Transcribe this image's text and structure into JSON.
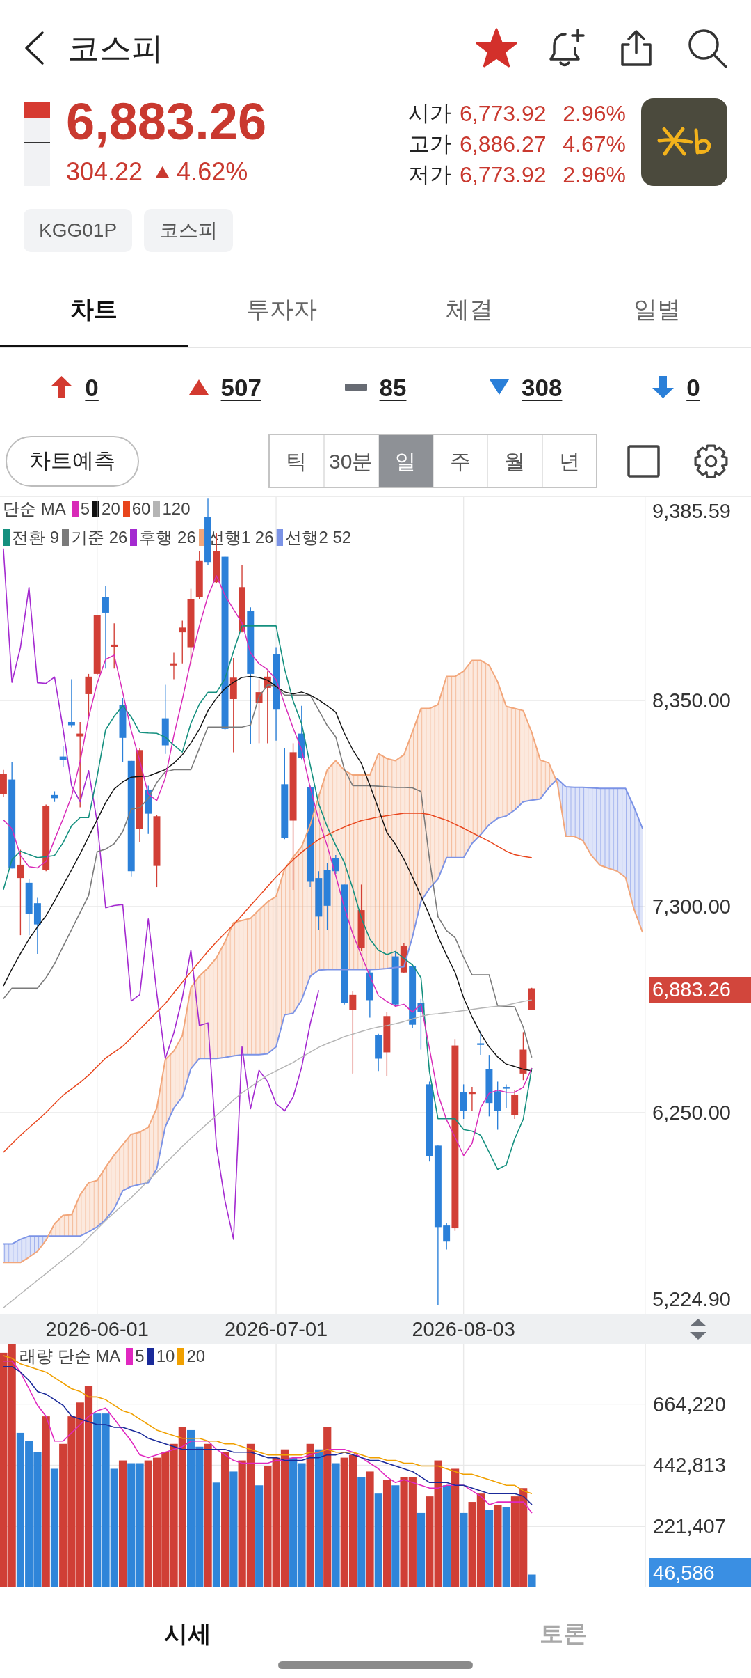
{
  "top_bar": {
    "title": "코스피",
    "favorite": true
  },
  "quote": {
    "gauge": {
      "level": 0.19
    },
    "price": "6,883.26",
    "change": "304.22",
    "rising": true,
    "change_rate": "4.62%",
    "ohlc": [
      {
        "label": "시가",
        "value": "6,773.92",
        "rate": "2.96%"
      },
      {
        "label": "고가",
        "value": "6,886.27",
        "rate": "4.67%"
      },
      {
        "label": "저가",
        "value": "6,773.92",
        "rate": "2.96%"
      }
    ]
  },
  "tags": [
    "KGG01P",
    "코스피"
  ],
  "tabs": [
    {
      "label": "차트",
      "selected": true
    },
    {
      "label": "투자자",
      "selected": false
    },
    {
      "label": "체결",
      "selected": false
    },
    {
      "label": "일별",
      "selected": false
    }
  ],
  "breadth": [
    {
      "kind": "upper_limit",
      "count": "0"
    },
    {
      "kind": "rise",
      "count": "507"
    },
    {
      "kind": "flat",
      "count": "85"
    },
    {
      "kind": "fall",
      "count": "308"
    },
    {
      "kind": "lower_limit",
      "count": "0"
    }
  ],
  "chart_toolbar": {
    "forecast_button": "차트예측",
    "periods": [
      {
        "label": "틱",
        "selected": false
      },
      {
        "label": "30분",
        "selected": false
      },
      {
        "label": "일",
        "selected": true
      },
      {
        "label": "주",
        "selected": false
      },
      {
        "label": "월",
        "selected": false
      },
      {
        "label": "년",
        "selected": false
      }
    ]
  },
  "price_chart": {
    "ma_legend_label": "단순 MA",
    "current_price": "6,883.26",
    "chart_data": {
      "type": "candlestick",
      "legend": "upper left",
      "grid": true,
      "categories": [
        null,
        null,
        null,
        null,
        null,
        null,
        null,
        null,
        null,
        null,
        null,
        "2026-06-01",
        null,
        null,
        null,
        null,
        null,
        null,
        null,
        null,
        null,
        null,
        null,
        null,
        null,
        null,
        null,
        null,
        null,
        null,
        null,
        null,
        "2026-07-01",
        null,
        null,
        null,
        null,
        null,
        null,
        null,
        null,
        null,
        null,
        null,
        null,
        null,
        null,
        null,
        null,
        null,
        null,
        null,
        null,
        null,
        "2026-08-03",
        null,
        null,
        null,
        null,
        null,
        null,
        null,
        null,
        null,
        null,
        null,
        null,
        null,
        null,
        null,
        null,
        null,
        null,
        null,
        null,
        null
      ],
      "ylim": [
        5224.9,
        9385.59
      ],
      "yticks": [
        {
          "value": 9385.59,
          "label": "9,385.59"
        },
        {
          "value": 8350,
          "label": "8,350.00"
        },
        {
          "value": 7300,
          "label": "7,300.00"
        },
        {
          "value": 6250,
          "label": "6,250.00"
        },
        {
          "value": 5224.9,
          "label": "5,224.90"
        }
      ],
      "ohlc": [
        [
          7874,
          7996,
          7860,
          7977
        ],
        [
          7947,
          8037,
          7494,
          7494
        ],
        [
          7445,
          7589,
          7154,
          7513
        ],
        [
          7421,
          7440,
          7154,
          7263
        ],
        [
          7317,
          7344,
          7059,
          7209
        ],
        [
          7486,
          7820,
          7480,
          7811
        ],
        [
          7868,
          7887,
          7833,
          7852
        ],
        [
          8064,
          8118,
          8010,
          8045
        ],
        [
          8240,
          8458,
          8213,
          8224
        ],
        [
          8167,
          8240,
          7805,
          8181
        ],
        [
          8382,
          8485,
          8268,
          8471
        ],
        [
          8485,
          8783,
          8479,
          8783
        ],
        [
          8878,
          8933,
          8512,
          8797
        ],
        [
          8623,
          8743,
          8512,
          8634
        ],
        [
          8327,
          8363,
          8037,
          8159
        ],
        [
          8042,
          8042,
          7453,
          7480
        ],
        [
          7697,
          8105,
          7630,
          8097
        ],
        [
          7896,
          7915,
          7670,
          7773
        ],
        [
          7507,
          7765,
          7399,
          7760
        ],
        [
          8259,
          8430,
          8078,
          8121
        ],
        [
          8528,
          8593,
          8458,
          8539
        ],
        [
          8697,
          8756,
          8539,
          8721
        ],
        [
          8621,
          8919,
          8539,
          8865
        ],
        [
          8878,
          9109,
          8865,
          9060
        ],
        [
          9286,
          9381,
          9041,
          9055
        ],
        [
          8952,
          9204,
          8946,
          9109
        ],
        [
          9082,
          9082,
          8200,
          8205
        ],
        [
          8357,
          8566,
          8086,
          8466
        ],
        [
          8702,
          9041,
          8697,
          8927
        ],
        [
          8805,
          8824,
          8126,
          8485
        ],
        [
          8338,
          8458,
          8132,
          8392
        ],
        [
          8414,
          8498,
          8132,
          8471
        ],
        [
          8585,
          8621,
          8145,
          8303
        ],
        [
          7923,
          8105,
          7643,
          7649
        ],
        [
          7738,
          8132,
          7385,
          8086
        ],
        [
          8181,
          8322,
          8050,
          8059
        ],
        [
          7909,
          7915,
          7399,
          7426
        ],
        [
          7445,
          7480,
          7182,
          7249
        ],
        [
          7486,
          7521,
          7182,
          7304
        ],
        [
          7548,
          7562,
          7467,
          7480
        ],
        [
          7412,
          7412,
          6801,
          6807
        ],
        [
          6774,
          6869,
          6449,
          6850
        ],
        [
          7087,
          7412,
          7073,
          7282
        ],
        [
          6964,
          6978,
          6734,
          6823
        ],
        [
          6644,
          6652,
          6462,
          6525
        ],
        [
          6557,
          6761,
          6435,
          6742
        ],
        [
          7046,
          7073,
          6788,
          6801
        ],
        [
          6964,
          7114,
          6959,
          7100
        ],
        [
          6997,
          7005,
          6679,
          6698
        ],
        [
          6807,
          6829,
          6571,
          6761
        ],
        [
          6394,
          6408,
          6001,
          6028
        ],
        [
          6082,
          6082,
          5268,
          5667
        ],
        [
          5675,
          5688,
          5553,
          5593
        ],
        [
          5661,
          6625,
          5648,
          6592
        ],
        [
          6354,
          6394,
          6218,
          6258
        ],
        [
          6345,
          6381,
          6258,
          6354
        ],
        [
          6603,
          6666,
          6544,
          6595
        ],
        [
          6470,
          6544,
          6231,
          6299
        ],
        [
          6359,
          6408,
          6163,
          6258
        ],
        [
          6381,
          6394,
          6272,
          6372
        ],
        [
          6237,
          6367,
          6218,
          6340
        ],
        [
          6449,
          6660,
          6416,
          6571
        ],
        [
          6774,
          6886,
          6774,
          6883
        ],
        null,
        null,
        null,
        null,
        null,
        null,
        null,
        null,
        null,
        null,
        null,
        null,
        null
      ],
      "series": [
        {
          "name": "5",
          "type": "line",
          "color": "#d82ab8",
          "values": [
            7742,
            7696,
            7560,
            7503,
            7497,
            7530,
            7641,
            7747,
            7861,
            8038,
            8263,
            8437,
            8559,
            8581,
            8391,
            8195,
            8043,
            7872,
            7840,
            7954,
            8171,
            8355,
            8554,
            8730,
            8882,
            8985,
            8885,
            8814,
            8744,
            8592,
            8537,
            8507,
            8456,
            8331,
            8209,
            8098,
            7907,
            7742,
            7609,
            7457,
            7297,
            7161,
            7052,
            6946,
            6846,
            6816,
            6792,
            6802,
            6762,
            6802,
            6577,
            6344,
            6213,
            6124,
            6031,
            6094,
            6276,
            6349,
            6365,
            6354,
            6354,
            6379,
            6477,
            null,
            null,
            null,
            null,
            null,
            null,
            null,
            null,
            null,
            null,
            null,
            null,
            null
          ]
        },
        {
          "name": "20",
          "type": "line",
          "color": "#111111",
          "values": [
            6895,
            6982,
            7060,
            7134,
            7196,
            7253,
            7329,
            7408,
            7487,
            7568,
            7655,
            7742,
            7829,
            7899,
            7935,
            7959,
            7962,
            7964,
            7981,
            7997,
            8030,
            8073,
            8133,
            8203,
            8298,
            8361,
            8410,
            8442,
            8467,
            8472,
            8467,
            8453,
            8421,
            8393,
            8383,
            8393,
            8377,
            8353,
            8323,
            8290,
            8184,
            8098,
            8030,
            7918,
            7799,
            7677,
            7617,
            7541,
            7451,
            7354,
            7256,
            7147,
            7052,
            6965,
            6835,
            6737,
            6653,
            6585,
            6534,
            6498,
            6485,
            6471,
            6463,
            null,
            null,
            null,
            null,
            null,
            null,
            null,
            null,
            null,
            null,
            null,
            null,
            null
          ]
        },
        {
          "name": "60",
          "type": "line",
          "color": "#e8451c",
          "values": [
            6048,
            6091,
            6134,
            6173,
            6211,
            6251,
            6295,
            6338,
            6371,
            6404,
            6441,
            6485,
            6528,
            6558,
            6588,
            6631,
            6675,
            6718,
            6762,
            6805,
            6860,
            6914,
            6967,
            7020,
            7072,
            7120,
            7164,
            7207,
            7256,
            7305,
            7353,
            7402,
            7451,
            7495,
            7538,
            7577,
            7610,
            7642,
            7664,
            7686,
            7705,
            7722,
            7738,
            7747,
            7756,
            7763,
            7769,
            7775,
            7775,
            7775,
            7769,
            7754,
            7740,
            7719,
            7699,
            7676,
            7654,
            7632,
            7607,
            7582,
            7564,
            7555,
            7549,
            null,
            null,
            null,
            null,
            null,
            null,
            null,
            null,
            null,
            null,
            null,
            null,
            null
          ]
        },
        {
          "name": "120",
          "type": "line",
          "color": "#b5b5b5",
          "values": [
            5256,
            5291,
            5326,
            5361,
            5396,
            5430,
            5466,
            5500,
            5535,
            5570,
            5613,
            5657,
            5700,
            5740,
            5779,
            5817,
            5860,
            5904,
            5947,
            5991,
            6034,
            6078,
            6119,
            6158,
            6197,
            6236,
            6275,
            6314,
            6351,
            6381,
            6411,
            6440,
            6462,
            6484,
            6506,
            6532,
            6558,
            6583,
            6602,
            6619,
            6637,
            6650,
            6663,
            6676,
            6686,
            6694,
            6703,
            6714,
            6727,
            6740,
            6750,
            6754,
            6759,
            6764,
            6770,
            6776,
            6782,
            6787,
            6792,
            6797,
            6807,
            6817,
            6824,
            null,
            null,
            null,
            null,
            null,
            null,
            null,
            null,
            null,
            null,
            null,
            null,
            null
          ]
        },
        {
          "name": "전환 9",
          "type": "line",
          "color": "#15907f",
          "values": [
            7386,
            7538,
            7582,
            7565,
            7549,
            7554,
            7560,
            7625,
            7712,
            7753,
            7753,
            7962,
            8201,
            8269,
            8323,
            8266,
            8187,
            8184,
            8182,
            8163,
            8122,
            8087,
            8233,
            8331,
            8391,
            8391,
            8461,
            8600,
            8730,
            8730,
            8730,
            8730,
            8730,
            8510,
            8347,
            8231,
            8021,
            7823,
            7707,
            7612,
            7525,
            7392,
            7242,
            7134,
            7077,
            7055,
            7071,
            7036,
            7003,
            6938,
            6458,
            6219,
            6219,
            6219,
            6164,
            6156,
            6135,
            6048,
            5961,
            5983,
            6116,
            6216,
            6477,
            null,
            null,
            null,
            null,
            null,
            null,
            null,
            null,
            null,
            null,
            null,
            null,
            null
          ]
        },
        {
          "name": "기준 26",
          "type": "line",
          "color": "#7a7a7a",
          "values": [
            6830,
            6884,
            6884,
            6884,
            6884,
            6938,
            7009,
            7096,
            7183,
            7269,
            7356,
            7579,
            7592,
            7620,
            7682,
            7796,
            7804,
            7850,
            7932,
            7986,
            7997,
            7997,
            7997,
            8106,
            8214,
            8214,
            8214,
            8214,
            8214,
            8225,
            8369,
            8429,
            8423,
            8377,
            8377,
            8377,
            8377,
            8301,
            8222,
            8165,
            8000,
            7916,
            7916,
            7916,
            7913,
            7910,
            7907,
            7907,
            7905,
            7886,
            7541,
            7248,
            7177,
            7142,
            7041,
            6952,
            6952,
            6952,
            6794,
            6792,
            6789,
            6686,
            6531,
            null,
            null,
            null,
            null,
            null,
            null,
            null,
            null,
            null,
            null,
            null,
            null,
            null
          ]
        },
        {
          "name": "후행 26",
          "type": "line",
          "color": "#a42ad0",
          "values": [
            9124,
            8442,
            8619,
            8926,
            8440,
            8437,
            8469,
            8206,
            7916,
            7834,
            7992,
            7731,
            7294,
            7305,
            7310,
            6819,
            6851,
            7237,
            6857,
            6526,
            6656,
            6835,
            7077,
            6694,
            6707,
            6078,
            5801,
            5605,
            6585,
            6270,
            6466,
            6409,
            6295,
            6259,
            6330,
            6482,
            6702,
            6873,
            null,
            null,
            null,
            null,
            null,
            null,
            null,
            null,
            null,
            null,
            null,
            null,
            null,
            null,
            null,
            null,
            null,
            null,
            null,
            null,
            null,
            null,
            null,
            null,
            null,
            null,
            null,
            null,
            null,
            null,
            null,
            null,
            null,
            null,
            null,
            null,
            null,
            null
          ]
        },
        {
          "name": "선행1 26",
          "type": "line",
          "color": "#f2a67a",
          "values": [
            5486,
            5486,
            5486,
            5513,
            5543,
            5600,
            5684,
            5727,
            5730,
            5831,
            5893,
            5904,
            5972,
            6034,
            6086,
            6140,
            6151,
            6175,
            6273,
            6520,
            6564,
            6642,
            6887,
            6946,
            6987,
            7039,
            7120,
            7218,
            7229,
            7240,
            7283,
            7324,
            7351,
            7492,
            7552,
            7606,
            7715,
            7861,
            7997,
            8043,
            7994,
            7970,
            7970,
            7970,
            8079,
            8054,
            8043,
            8073,
            8190,
            8309,
            8309,
            8328,
            8472,
            8472,
            8499,
            8554,
            8554,
            8529,
            8445,
            8320,
            8309,
            8298,
            8187,
            8046,
            8032,
            7929,
            7658,
            7658,
            7636,
            7560,
            7511,
            7495,
            7481,
            7449,
            7286,
            7169
          ]
        },
        {
          "name": "선행2 52",
          "type": "line",
          "color": "#7b93e6",
          "values": [
            5581,
            5581,
            5605,
            5621,
            5621,
            5621,
            5621,
            5621,
            5621,
            5621,
            5643,
            5668,
            5706,
            5760,
            5852,
            5874,
            5885,
            5893,
            5964,
            6178,
            6273,
            6330,
            6474,
            6526,
            6526,
            6526,
            6531,
            6539,
            6545,
            6545,
            6545,
            6550,
            6585,
            6748,
            6756,
            6824,
            6944,
            6976,
            6979,
            6979,
            6979,
            6979,
            6979,
            6979,
            6981,
            6984,
            6990,
            6993,
            7145,
            7326,
            7392,
            7440,
            7549,
            7549,
            7549,
            7622,
            7666,
            7717,
            7750,
            7761,
            7791,
            7834,
            7842,
            7848,
            7905,
            7951,
            7910,
            7907,
            7907,
            7905,
            7902,
            7902,
            7902,
            7902,
            7807,
            7698
          ]
        }
      ]
    }
  },
  "volume_chart": {
    "legend_label": "래량 단순 MA",
    "current_volume": "46,586",
    "chart_data": {
      "type": "bar",
      "legend": "upper left",
      "grid": true,
      "stacked": true,
      "categories": [
        null,
        null,
        null,
        null,
        null,
        null,
        null,
        null,
        null,
        null,
        null,
        null,
        null,
        null,
        null,
        null,
        null,
        null,
        null,
        null,
        null,
        null,
        null,
        null,
        null,
        null,
        null,
        null,
        null,
        null,
        null,
        null,
        null,
        null,
        null,
        null,
        null,
        null,
        null,
        null,
        null,
        null,
        null,
        null,
        null,
        null,
        null,
        null,
        null,
        null,
        null,
        null,
        null,
        null,
        null,
        null,
        null,
        null,
        null,
        null,
        null,
        null,
        null
      ],
      "ylim": [
        0,
        880000
      ],
      "yticks": [
        {
          "value": 664220,
          "label": "664,220"
        },
        {
          "value": 442813,
          "label": "442,813"
        },
        {
          "value": 221407,
          "label": "221,407"
        }
      ],
      "series": [
        {
          "color": "#d03f36",
          "values": [
            850000,
            880000,
            null,
            null,
            null,
            620000,
            null,
            520000,
            620000,
            670000,
            730000,
            null,
            null,
            null,
            460000,
            null,
            null,
            460000,
            470000,
            490000,
            520000,
            580000,
            null,
            null,
            520000,
            null,
            490000,
            null,
            460000,
            520000,
            null,
            440000,
            470000,
            500000,
            null,
            null,
            520000,
            null,
            580000,
            null,
            470000,
            480000,
            null,
            420000,
            null,
            390000,
            null,
            400000,
            400000,
            null,
            330000,
            460000,
            null,
            430000,
            null,
            310000,
            340000,
            null,
            300000,
            null,
            330000,
            360000,
            null
          ]
        },
        {
          "color": "#2f85d9",
          "values": [
            null,
            null,
            560000,
            530000,
            490000,
            null,
            430000,
            null,
            null,
            null,
            null,
            630000,
            630000,
            430000,
            null,
            450000,
            450000,
            null,
            null,
            null,
            null,
            null,
            570000,
            510000,
            null,
            380000,
            null,
            420000,
            null,
            null,
            370000,
            null,
            null,
            null,
            470000,
            450000,
            null,
            500000,
            null,
            450000,
            null,
            null,
            400000,
            null,
            340000,
            null,
            370000,
            null,
            null,
            270000,
            null,
            null,
            370000,
            null,
            270000,
            null,
            null,
            280000,
            null,
            290000,
            null,
            null,
            46586
          ]
        },
        {
          "name": "5",
          "type": "line",
          "color": "#e028c0",
          "values": [
            820000,
            820000,
            780000,
            720000,
            660000,
            620000,
            530000,
            530000,
            560000,
            590000,
            620000,
            640000,
            650000,
            610000,
            570000,
            530000,
            480000,
            470000,
            480000,
            490000,
            500000,
            510000,
            530000,
            530000,
            530000,
            500000,
            480000,
            460000,
            450000,
            450000,
            450000,
            450000,
            460000,
            460000,
            470000,
            470000,
            480000,
            490000,
            500000,
            500000,
            500000,
            490000,
            470000,
            450000,
            430000,
            400000,
            380000,
            390000,
            380000,
            370000,
            360000,
            360000,
            370000,
            370000,
            370000,
            350000,
            330000,
            300000,
            310000,
            310000,
            310000,
            310000,
            270000
          ]
        },
        {
          "name": "10",
          "type": "line",
          "color": "#1a2a9a",
          "values": [
            800000,
            800000,
            780000,
            750000,
            710000,
            700000,
            680000,
            660000,
            620000,
            610000,
            600000,
            590000,
            590000,
            580000,
            580000,
            570000,
            560000,
            540000,
            530000,
            520000,
            510000,
            500000,
            500000,
            500000,
            500000,
            500000,
            500000,
            490000,
            490000,
            490000,
            480000,
            470000,
            470000,
            460000,
            460000,
            460000,
            470000,
            470000,
            480000,
            480000,
            490000,
            480000,
            470000,
            460000,
            460000,
            450000,
            440000,
            430000,
            420000,
            400000,
            380000,
            380000,
            380000,
            370000,
            370000,
            360000,
            350000,
            340000,
            340000,
            340000,
            340000,
            330000,
            300000
          ]
        },
        {
          "name": "20",
          "type": "line",
          "color": "#f0a000",
          "values": [
            840000,
            830000,
            810000,
            800000,
            790000,
            780000,
            760000,
            740000,
            720000,
            710000,
            690000,
            690000,
            680000,
            660000,
            640000,
            630000,
            610000,
            590000,
            570000,
            560000,
            550000,
            540000,
            540000,
            540000,
            530000,
            530000,
            520000,
            520000,
            510000,
            500000,
            490000,
            480000,
            480000,
            480000,
            480000,
            480000,
            490000,
            490000,
            500000,
            490000,
            490000,
            490000,
            480000,
            470000,
            470000,
            460000,
            460000,
            450000,
            450000,
            440000,
            440000,
            440000,
            430000,
            420000,
            410000,
            410000,
            400000,
            390000,
            380000,
            370000,
            370000,
            350000,
            340000
          ]
        }
      ]
    }
  },
  "bottom_tabs": [
    {
      "label": "시세",
      "selected": true
    },
    {
      "label": "토론",
      "selected": false
    }
  ]
}
